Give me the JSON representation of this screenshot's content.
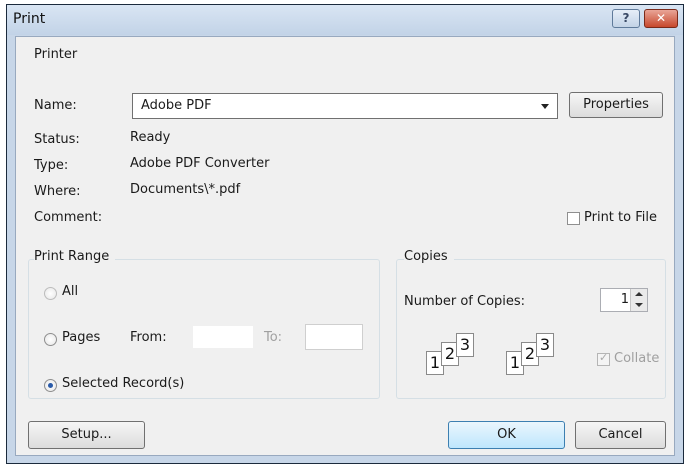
{
  "window": {
    "title": "Print",
    "help_glyph": "?",
    "close_glyph": "✕"
  },
  "printer": {
    "section": "Printer",
    "name_label": "Name:",
    "name_value": "Adobe PDF",
    "properties_button": "Properties",
    "status_label": "Status:",
    "status_value": "Ready",
    "type_label": "Type:",
    "type_value": "Adobe PDF Converter",
    "where_label": "Where:",
    "where_value": "Documents\\*.pdf",
    "comment_label": "Comment:",
    "print_to_file": "Print to File"
  },
  "print_range": {
    "section": "Print Range",
    "all": "All",
    "pages": "Pages",
    "from_label": "From:",
    "to_label": "To:",
    "selected": "Selected Record(s)",
    "selected_option": "Selected Record(s)"
  },
  "copies": {
    "section": "Copies",
    "number_label": "Number of Copies:",
    "number_value": "1",
    "collate_label": "Collate",
    "page_nums": [
      "1",
      "2",
      "3"
    ]
  },
  "footer": {
    "setup_button": "Setup...",
    "ok_button": "OK",
    "cancel_button": "Cancel"
  }
}
